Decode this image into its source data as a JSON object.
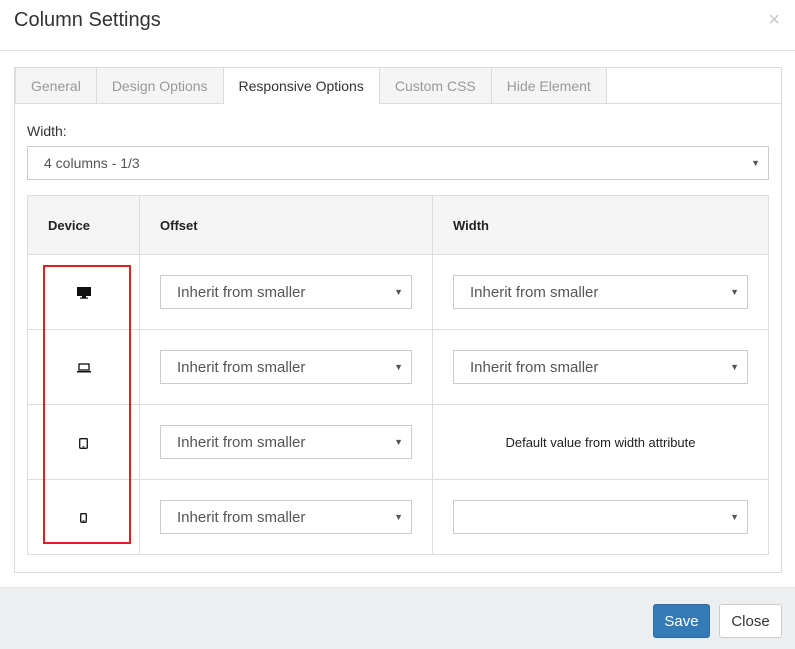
{
  "dialog": {
    "title": "Column Settings",
    "close_glyph": "×"
  },
  "tabs": [
    {
      "label": "General",
      "active": false
    },
    {
      "label": "Design Options",
      "active": false
    },
    {
      "label": "Responsive Options",
      "active": true
    },
    {
      "label": "Custom CSS",
      "active": false
    },
    {
      "label": "Hide Element",
      "active": false
    }
  ],
  "width_field": {
    "label": "Width:",
    "value": "4 columns - 1/3"
  },
  "table": {
    "headers": {
      "device": "Device",
      "offset": "Offset",
      "width": "Width"
    },
    "rows": [
      {
        "device_icon": "desktop-icon",
        "offset": "Inherit from smaller",
        "width": "Inherit from smaller"
      },
      {
        "device_icon": "laptop-icon",
        "offset": "Inherit from smaller",
        "width": "Inherit from smaller"
      },
      {
        "device_icon": "tablet-icon",
        "offset": "Inherit from smaller",
        "width_text": "Default value from width attribute"
      },
      {
        "device_icon": "phone-icon",
        "offset": "Inherit from smaller",
        "width": ""
      }
    ]
  },
  "footer": {
    "save_label": "Save",
    "close_label": "Close"
  },
  "colors": {
    "primary": "#337ab7",
    "highlight": "#e02020"
  }
}
